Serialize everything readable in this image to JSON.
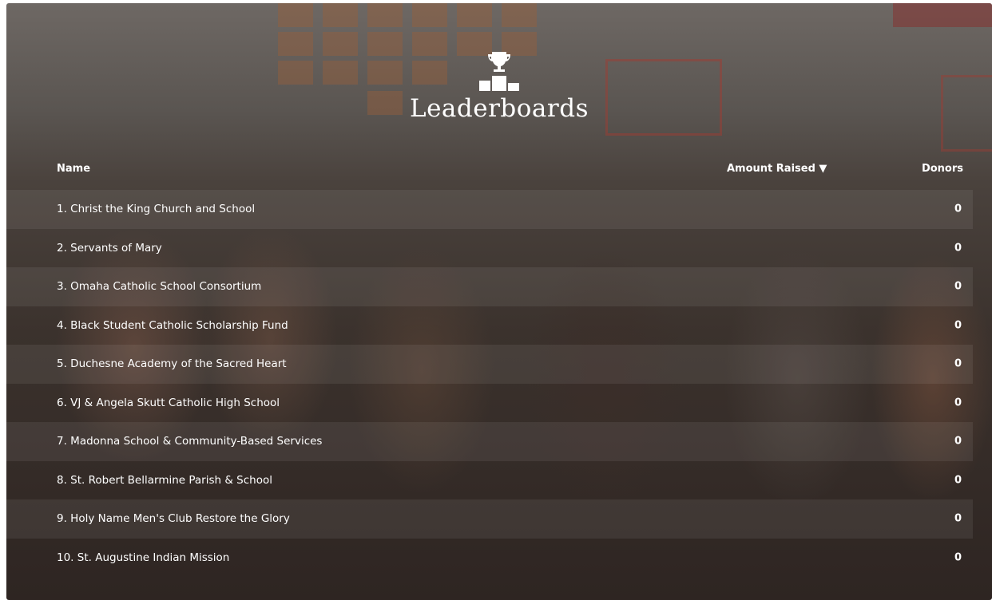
{
  "header": {
    "title": "Leaderboards",
    "icon": "trophy-podium-icon"
  },
  "columns": {
    "name": "Name",
    "amount": "Amount Raised ▼",
    "donors": "Donors"
  },
  "rows": [
    {
      "name": "1. Christ the King Church and School",
      "donors": "0"
    },
    {
      "name": "2. Servants of Mary",
      "donors": "0"
    },
    {
      "name": "3. Omaha Catholic School Consortium",
      "donors": "0"
    },
    {
      "name": "4. Black Student Catholic Scholarship Fund",
      "donors": "0"
    },
    {
      "name": "5. Duchesne Academy of the Sacred Heart",
      "donors": "0"
    },
    {
      "name": "6. VJ & Angela Skutt Catholic High School",
      "donors": "0"
    },
    {
      "name": "7. Madonna School & Community-Based Services",
      "donors": "0"
    },
    {
      "name": "8. St. Robert Bellarmine Parish & School",
      "donors": "0"
    },
    {
      "name": "9. Holy Name Men's Club Restore the Glory",
      "donors": "0"
    },
    {
      "name": "10. St. Augustine Indian Mission",
      "donors": "0"
    }
  ]
}
